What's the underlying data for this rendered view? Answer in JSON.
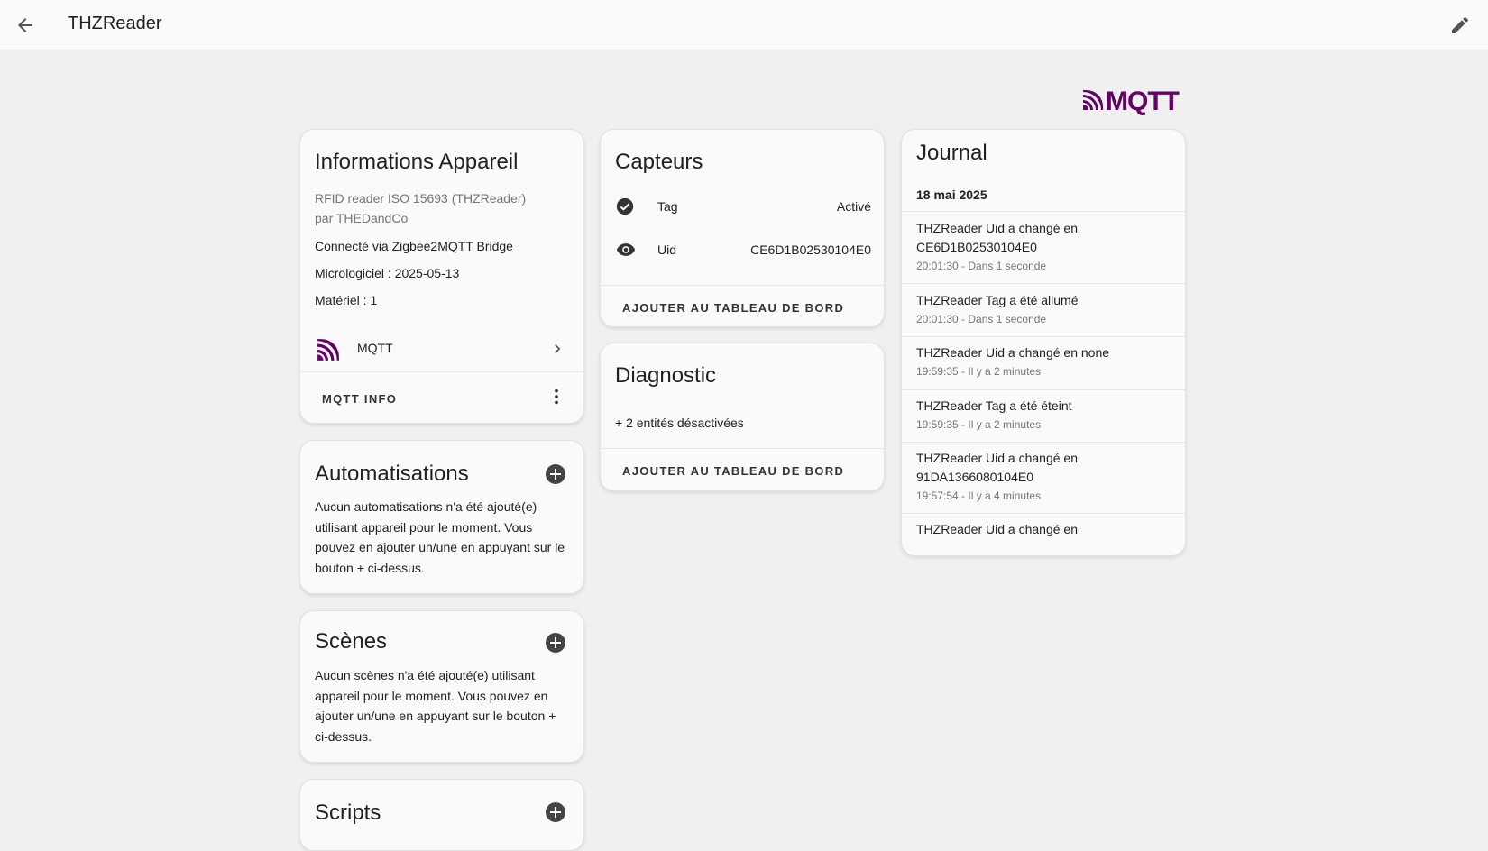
{
  "header": {
    "title": "THZReader",
    "back_icon": "arrow-left-icon",
    "edit_icon": "pencil-icon"
  },
  "brand": {
    "logo_text": "MQTT",
    "color": "#660066"
  },
  "device_info": {
    "title": "Informations Appareil",
    "model_line": "RFID reader ISO 15693 (THZReader)",
    "manufacturer_line": "par THEDandCo",
    "connected_prefix": "Connecté via ",
    "connected_link": "Zigbee2MQTT Bridge",
    "firmware": "Micrologiciel : 2025-05-13",
    "hardware": "Matériel : 1",
    "integration_label": "MQTT",
    "integration_icon": "mqtt-icon",
    "action_button": "MQTT INFO",
    "more_icon": "dots-vertical-icon"
  },
  "automations": {
    "title": "Automatisations",
    "text": "Aucun automatisations n'a été ajouté(e) utilisant appareil pour le moment. Vous pouvez en ajouter un/une en appuyant sur le bouton + ci-dessus."
  },
  "scenes": {
    "title": "Scènes",
    "text": "Aucun scènes n'a été ajouté(e) utilisant appareil pour le moment. Vous pouvez en ajouter un/une en appuyant sur le bouton + ci-dessus."
  },
  "scripts": {
    "title": "Scripts"
  },
  "sensors": {
    "title": "Capteurs",
    "rows": [
      {
        "icon": "check-circle-icon",
        "label": "Tag",
        "value": "Activé"
      },
      {
        "icon": "eye-icon",
        "label": "Uid",
        "value": "CE6D1B02530104E0"
      }
    ],
    "action_button": "AJOUTER AU TABLEAU DE BORD"
  },
  "diagnostic": {
    "title": "Diagnostic",
    "disabled_entities": "+ 2 entités désactivées",
    "action_button": "AJOUTER AU TABLEAU DE BORD"
  },
  "journal": {
    "title": "Journal",
    "date": "18 mai 2025",
    "entries": [
      {
        "title": "THZReader Uid a changé en CE6D1B02530104E0",
        "time": "20:01:30 - Dans 1 seconde"
      },
      {
        "title": "THZReader Tag a été allumé",
        "time": "20:01:30 - Dans 1 seconde"
      },
      {
        "title": "THZReader Uid a changé en none",
        "time": "19:59:35 - Il y a 2 minutes"
      },
      {
        "title": "THZReader Tag a été éteint",
        "time": "19:59:35 - Il y a 2 minutes"
      },
      {
        "title": "THZReader Uid a changé en 91DA1366080104E0",
        "time": "19:57:54 - Il y a 4 minutes"
      },
      {
        "title": "THZReader Uid a changé en",
        "time": ""
      }
    ]
  }
}
